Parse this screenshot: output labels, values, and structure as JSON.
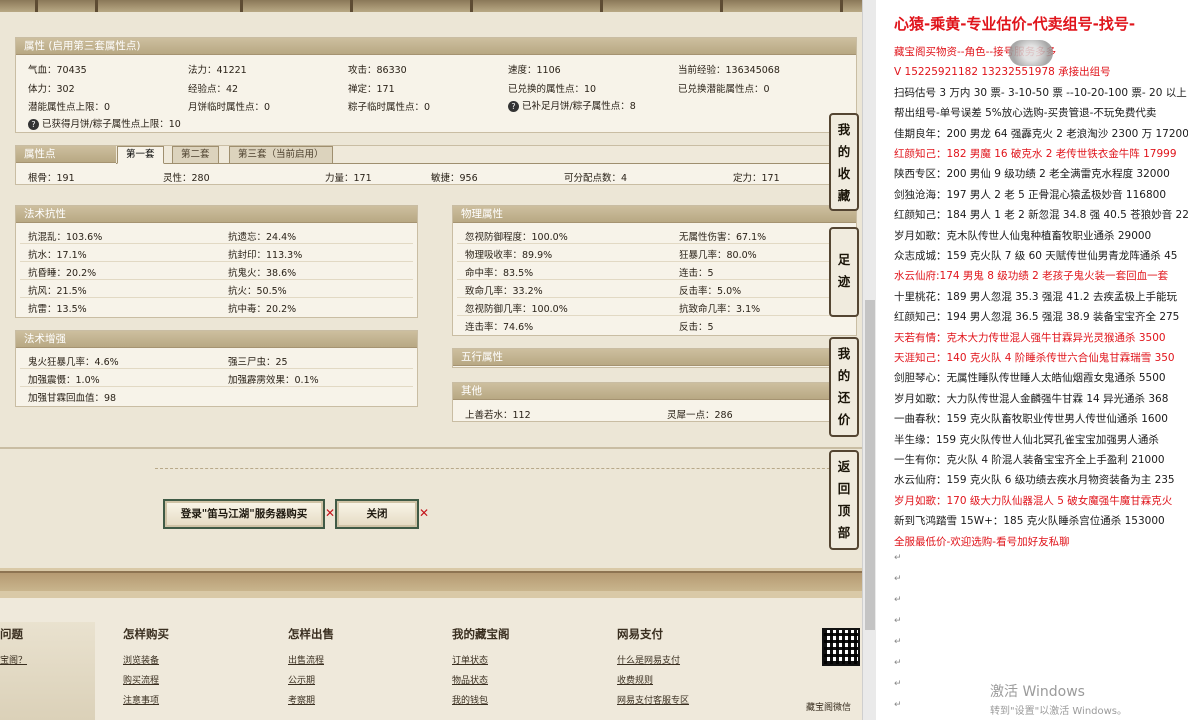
{
  "attr_panel": {
    "title": "属性 (启用第三套属性点)",
    "rows": [
      [
        "气血：70435",
        "法力：41221",
        "攻击：86330",
        "速度：1106",
        "当前经验：136345068"
      ],
      [
        "体力：302",
        "经验点：42",
        "禅定：171",
        "已兑换的属性点：10",
        "已兑换潜能属性点：0"
      ],
      [
        "潜能属性点上限：0",
        "月饼临时属性点：0",
        "粽子临时属性点：0",
        "已补足月饼/粽子属性点：8",
        ""
      ],
      [
        "已获得月饼/粽子属性点上限：10"
      ]
    ]
  },
  "points_panel": {
    "title": "属性点",
    "tabs": [
      "第一套",
      "第二套",
      "第三套（当前启用）"
    ],
    "values": [
      "根骨：191",
      "灵性：280",
      "力量：171",
      "敏捷：956",
      "可分配点数：4",
      "定力：171"
    ]
  },
  "magic_resist": {
    "title": "法术抗性",
    "rows": [
      [
        "抗混乱：103.6%",
        "抗遗忘：24.4%"
      ],
      [
        "抗水：17.1%",
        "抗封印：113.3%"
      ],
      [
        "抗昏睡：20.2%",
        "抗鬼火：38.6%"
      ],
      [
        "抗风：21.5%",
        "抗火：50.5%"
      ],
      [
        "抗雷：13.5%",
        "抗中毒：20.2%"
      ]
    ]
  },
  "magic_boost": {
    "title": "法术增强",
    "rows": [
      [
        "鬼火狂暴几率：4.6%",
        "强三尸虫：25"
      ],
      [
        "加强震慑：1.0%",
        "加强霹雳效果：0.1%"
      ],
      [
        "加强甘霖回血值：98",
        ""
      ]
    ]
  },
  "phys_attr": {
    "title": "物理属性",
    "rows": [
      [
        "忽视防御程度：100.0%",
        "无属性伤害：67.1%"
      ],
      [
        "物理吸收率：89.9%",
        "狂暴几率：80.0%"
      ],
      [
        "命中率：83.5%",
        "连击：5"
      ],
      [
        "致命几率：33.2%",
        "反击率：5.0%"
      ],
      [
        "忽视防御几率：100.0%",
        "抗致命几率：3.1%"
      ],
      [
        "连击率：74.6%",
        "反击：5"
      ]
    ]
  },
  "five_elements": {
    "title": "五行属性"
  },
  "other": {
    "title": "其他",
    "rows": [
      [
        "上善若水：112",
        "灵犀一点：286"
      ]
    ]
  },
  "buttons": {
    "login_buy": "登录\"笛马江湖\"服务器购买",
    "close": "关闭"
  },
  "side_tabs": [
    "我的收藏",
    "足迹",
    "我的还价",
    "返回顶部"
  ],
  "footer": {
    "col0_title": "问题",
    "col0_links": [
      "宝阁？"
    ],
    "columns": [
      {
        "title": "怎样购买",
        "links": [
          "浏览装备",
          "购买流程",
          "注意事项"
        ]
      },
      {
        "title": "怎样出售",
        "links": [
          "出售流程",
          "公示期",
          "考察期"
        ]
      },
      {
        "title": "我的藏宝阁",
        "links": [
          "订单状态",
          "物品状态",
          "我的钱包"
        ]
      },
      {
        "title": "网易支付",
        "links": [
          "什么是网易支付",
          "收费规则",
          "网易支付客服专区"
        ]
      }
    ],
    "qr_caption": "藏宝阁微信"
  },
  "right_doc": {
    "title": "心猿-乘黄-专业估价-代卖组号-找号-",
    "lines": [
      {
        "t": "藏宝阁买物资--角色--接号服务多多",
        "red": true
      },
      {
        "t": "V 15225921182    13232551978 承接出组号",
        "red": true
      },
      {
        "t": "扫码估号 3 万内 30 票- 3-10-50 票  --10-20-100 票- 20 以上 1",
        "red": false
      },
      {
        "t": "帮出组号-单号误差 5%放心选购-买贵管退-不玩免费代卖",
        "red": false
      },
      {
        "t": "佳期良年：200 男龙 64 强霹克火 2 老浪淘沙 2300 万 17200",
        "red": false
      },
      {
        "t": "红颜知己：182 男魔 16 破克水 2 老传世铁衣金牛阵 17999",
        "red": true
      },
      {
        "t": "陕西专区：200 男仙 9 级功绩 2 老全满雷克水程度 32000",
        "red": false
      },
      {
        "t": "剑独沧海：197 男人 2 老 5 正骨混心猿孟极妙音 116800",
        "red": false
      },
      {
        "t": "红颜知己：184 男人 1 老 2 新忽混 34.8 强 40.5 苍狼妙音 22",
        "red": false
      },
      {
        "t": "岁月如歌：克木队传世人仙鬼种植畜牧职业通杀 29000",
        "red": false
      },
      {
        "t": "众志成城：159 克火队 7 级 60 天赋传世仙男青龙阵通杀 45",
        "red": false
      },
      {
        "t": "水云仙府:174 男鬼 8 级功绩 2 老孩子鬼火装一套回血一套",
        "red": true
      },
      {
        "t": "十里桃花：189 男人忽混 35.3 强混 41.2 去疾孟极上手能玩",
        "red": false
      },
      {
        "t": "红颜知己：194 男人忽混 36.5 强混 38.9 装备宝宝齐全 275",
        "red": false
      },
      {
        "t": "天若有情：克木大力传世混人强牛甘霖异光灵猴通杀 3500",
        "red": true
      },
      {
        "t": "天涯知己：140 克火队 4 阶睡杀传世六合仙鬼甘霖瑞雪 350",
        "red": true
      },
      {
        "t": "剑胆琴心：无属性睡队传世睡人太皓仙烟霞女鬼通杀 5500",
        "red": false
      },
      {
        "t": "岁月如歌：大力队传世混人金麟强牛甘霖 14 异光通杀 368",
        "red": false
      },
      {
        "t": "一曲春秋：159 克火队畜牧职业传世男人传世仙通杀 1600",
        "red": false
      },
      {
        "t": "半生缘：159 克火队传世人仙北冥孔雀宝宝加强男人通杀",
        "red": false
      },
      {
        "t": "一生有你：克火队 4 阶混人装备宝宝齐全上手盈利 21000",
        "red": false
      },
      {
        "t": "水云仙府：159 克火队 6 级功绩去疾水月物资装备为主 235",
        "red": false
      },
      {
        "t": "岁月如歌：170 级大力队仙器混人 5 破女魔强牛魔甘霖克火",
        "red": true
      },
      {
        "t": "新到飞鸿踏雪 15W+：185 克火队睡杀宫位通杀 153000",
        "red": false
      },
      {
        "t": "全服最低价-欢迎选购-看号加好友私聊",
        "red": true
      }
    ],
    "watermark1": "激活 Windows",
    "watermark2": "转到\"设置\"以激活 Windows。"
  }
}
